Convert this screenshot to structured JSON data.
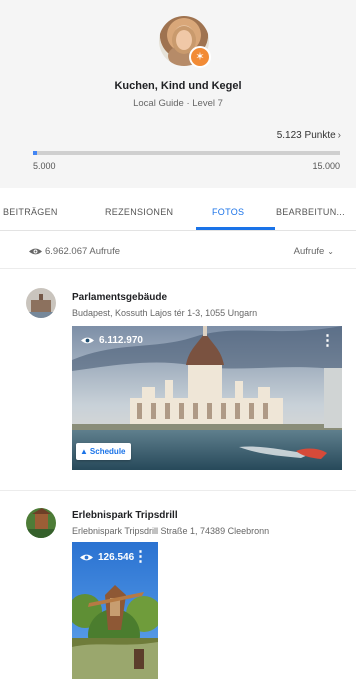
{
  "profile": {
    "name": "Kuchen, Kind und Kegel",
    "level": "Local Guide · Level 7",
    "points": "5.123 Punkte",
    "progress_min": "5.000",
    "progress_max": "15.000",
    "progress_fraction": 0.012,
    "badge_icon": "star-icon"
  },
  "tabs": [
    {
      "label": "BEITRÄGEN"
    },
    {
      "label": "REZENSIONEN"
    },
    {
      "label": "FOTOS"
    },
    {
      "label": "BEARBEITUN..."
    }
  ],
  "views": {
    "total": "6.962.067 Aufrufe",
    "sort_label": "Aufrufe"
  },
  "places": [
    {
      "title": "Parlamentsgebäude",
      "address": "Budapest, Kossuth Lajos tér 1-3, 1055 Ungarn",
      "photo_views": "6.112.970",
      "schedule_label": "Schedule"
    },
    {
      "title": "Erlebnispark Tripsdrill",
      "address": "Erlebnispark Tripsdrill Straße 1, 74389 Cleebronn",
      "photo_views": "126.546"
    }
  ],
  "colors": {
    "accent": "#1a73e8",
    "badge": "#f28b35",
    "header_bg": "#f5f5f5"
  }
}
